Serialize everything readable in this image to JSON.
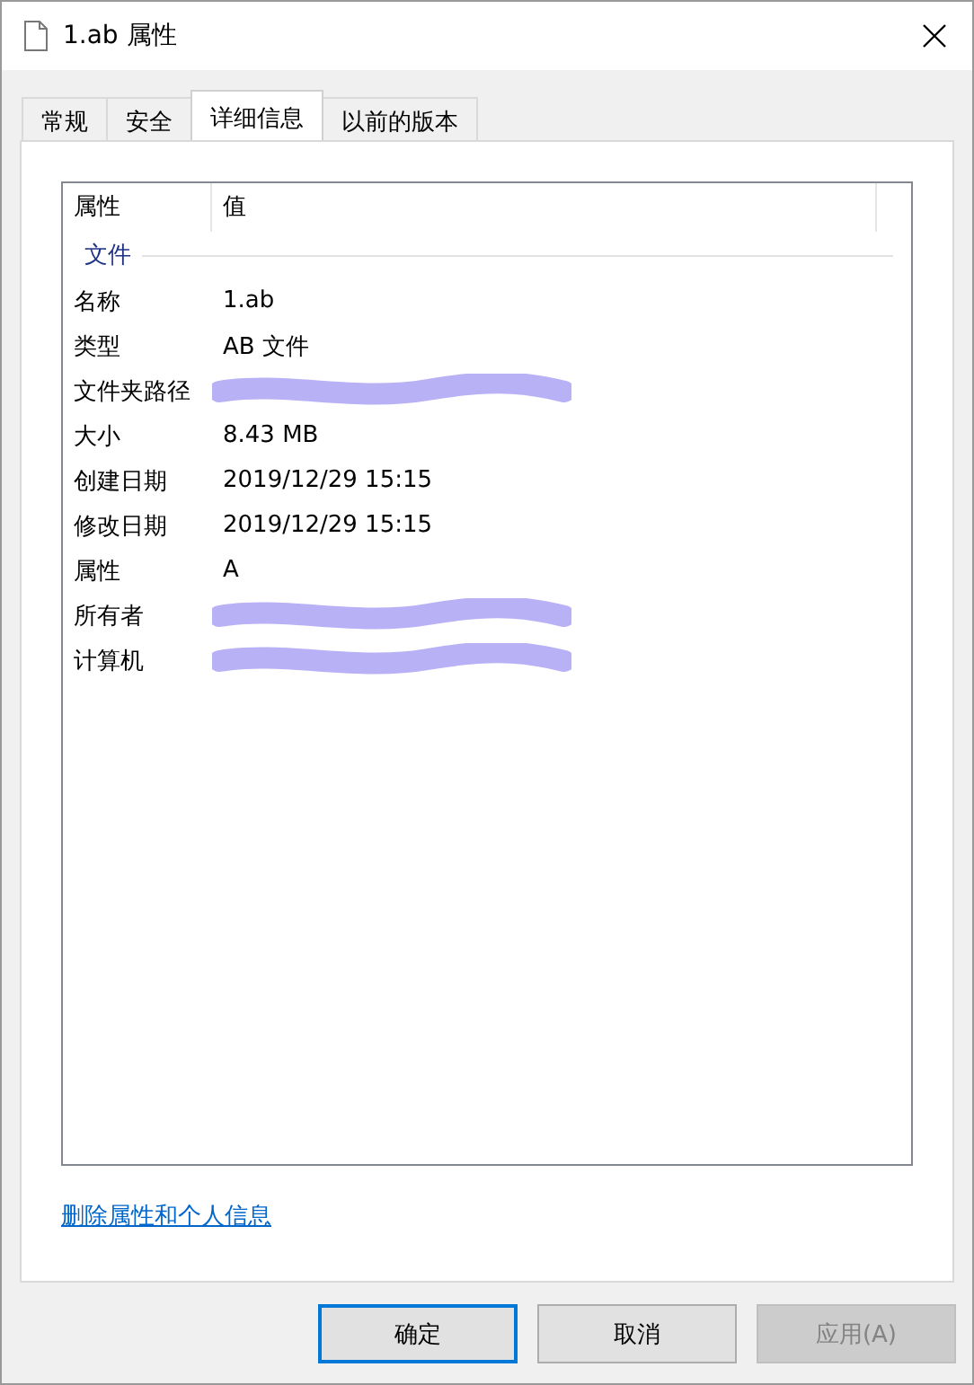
{
  "window": {
    "title": "1.ab 属性"
  },
  "tabs": [
    {
      "label": "常规",
      "selected": false
    },
    {
      "label": "安全",
      "selected": false
    },
    {
      "label": "详细信息",
      "selected": true
    },
    {
      "label": "以前的版本",
      "selected": false
    }
  ],
  "table": {
    "columns": [
      "属性",
      "值"
    ],
    "group": "文件",
    "rows": [
      {
        "name": "名称",
        "value": "1.ab",
        "redacted": false
      },
      {
        "name": "类型",
        "value": "AB 文件",
        "redacted": false
      },
      {
        "name": "文件夹路径",
        "redacted": true
      },
      {
        "name": "大小",
        "value": "8.43 MB",
        "redacted": false
      },
      {
        "name": "创建日期",
        "value": "2019/12/29 15:15",
        "redacted": false
      },
      {
        "name": "修改日期",
        "value": "2019/12/29 15:15",
        "redacted": false
      },
      {
        "name": "属性",
        "value": "A",
        "redacted": false
      },
      {
        "name": "所有者",
        "redacted": true
      },
      {
        "name": "计算机",
        "redacted": true
      }
    ]
  },
  "link": "删除属性和个人信息",
  "buttons": [
    {
      "label": "确定",
      "default": true,
      "disabled": false
    },
    {
      "label": "取消",
      "default": false,
      "disabled": false
    },
    {
      "label": "应用(A)",
      "default": false,
      "disabled": true
    }
  ]
}
